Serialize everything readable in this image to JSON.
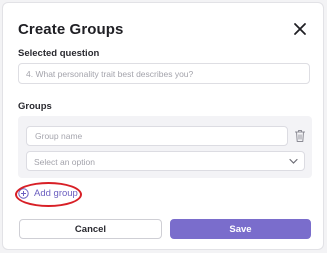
{
  "modal": {
    "title": "Create Groups",
    "close_icon": "close-icon"
  },
  "question": {
    "label": "Selected question",
    "value": "4. What personality trait best describes you?"
  },
  "groups": {
    "label": "Groups",
    "name_placeholder": "Group name",
    "select_placeholder": "Select an option",
    "add_label": "Add group"
  },
  "footer": {
    "cancel_label": "Cancel",
    "save_label": "Save"
  },
  "colors": {
    "accent": "#7a6dcc",
    "link": "#6b5fc0",
    "highlight": "#d81f26"
  }
}
